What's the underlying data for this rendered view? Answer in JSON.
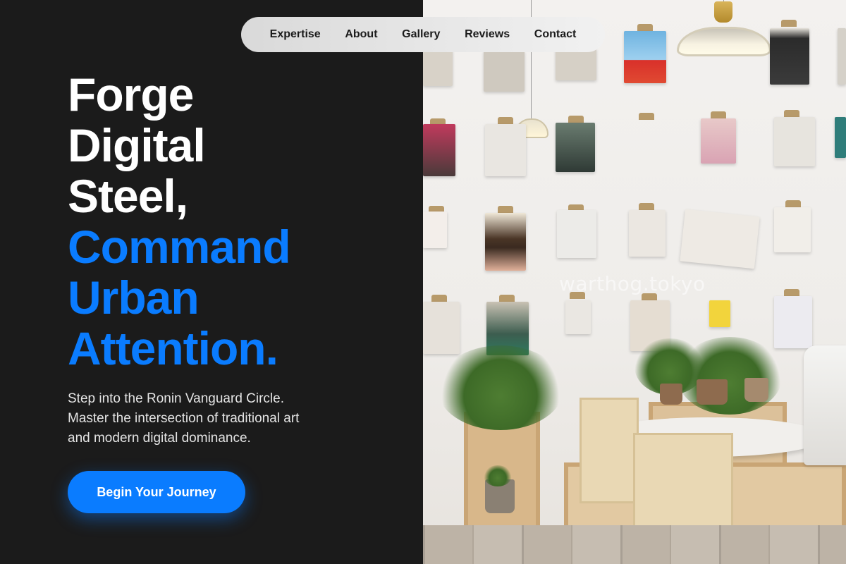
{
  "nav": {
    "items": [
      "Expertise",
      "About",
      "Gallery",
      "Reviews",
      "Contact"
    ]
  },
  "hero": {
    "headline_white": [
      "Forge",
      "Digital",
      "Steel,"
    ],
    "headline_blue": [
      "Command",
      "Urban",
      "Attention."
    ],
    "subtext": [
      "Step into the Ronin Vanguard Circle.",
      "Master the intersection of traditional art",
      "and modern digital dominance."
    ],
    "cta_label": "Begin Your Journey"
  },
  "photo": {
    "watermark": "warthog.tokyo"
  },
  "colors": {
    "background": "#1b1b1b",
    "accent": "#0a7cff",
    "headline": "#ffffff",
    "nav_bg": "#e3e3e3"
  }
}
